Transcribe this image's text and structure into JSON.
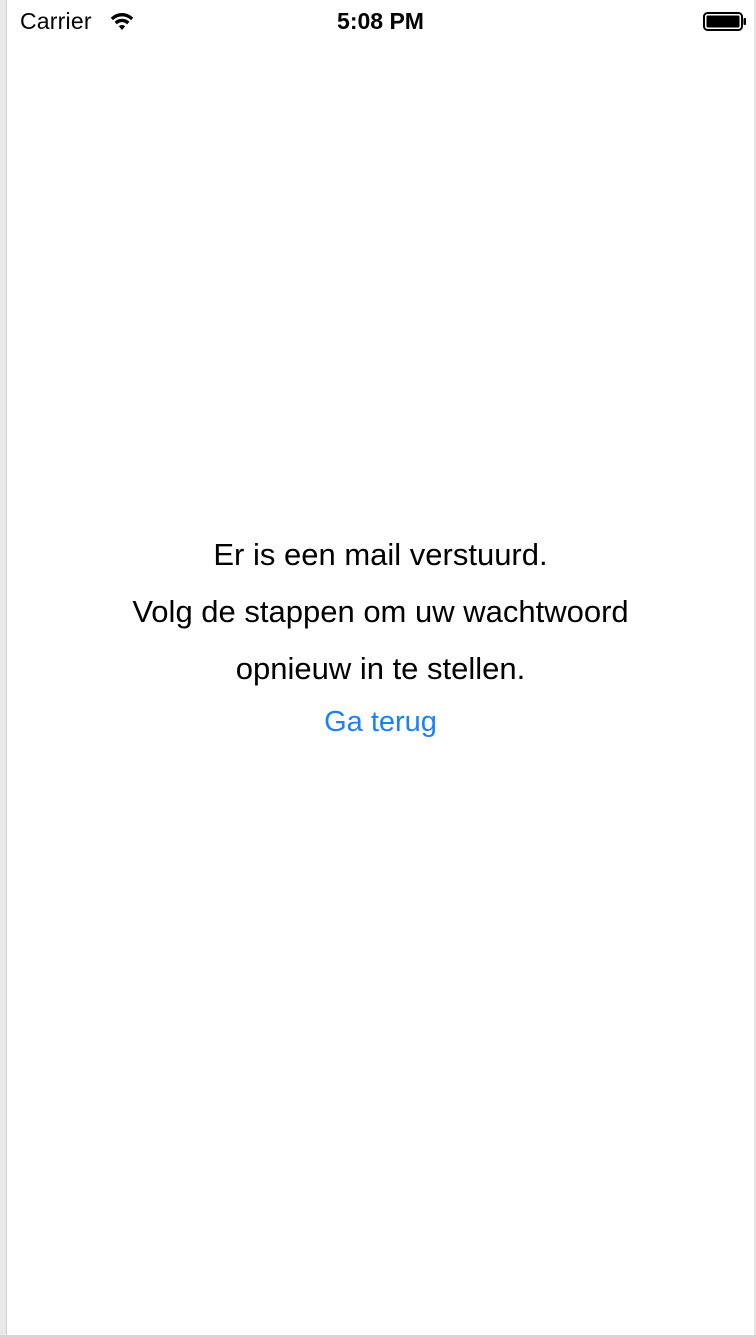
{
  "status_bar": {
    "carrier": "Carrier",
    "time": "5:08 PM",
    "wifi_icon": "wifi-icon",
    "battery_icon": "battery-icon"
  },
  "message": {
    "line1": "Er is een mail verstuurd.",
    "line2": "Volg de stappen om uw wachtwoord",
    "line3": "opnieuw in te stellen."
  },
  "back_link": {
    "label": "Ga terug",
    "color": "#1a82f7"
  }
}
